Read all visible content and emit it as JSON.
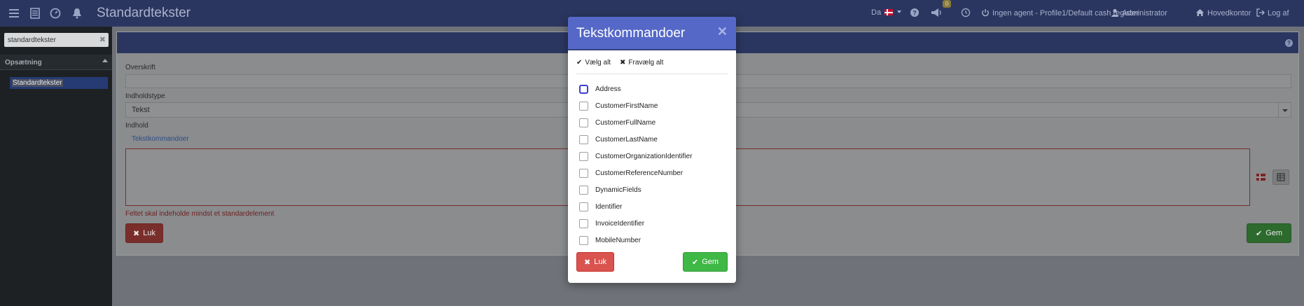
{
  "topbar": {
    "title": "Standardtekster",
    "language": "Da",
    "notification_count": "0",
    "agent": "Ingen agent - Profile1/Default cash register",
    "user": "Administrator",
    "office": "Hovedkontor",
    "logout": "Log af",
    "icons": [
      "menu-icon",
      "list-icon",
      "dashboard-icon",
      "bell-icon",
      "help-icon",
      "megaphone-icon",
      "clock-icon",
      "power-icon",
      "user-icon",
      "home-icon",
      "logout-icon"
    ]
  },
  "sidebar": {
    "search": {
      "value": "standardtekster",
      "placeholder": ""
    },
    "section": "Opsætning",
    "items": [
      {
        "label": "Standardtekster"
      }
    ]
  },
  "form": {
    "heading_label": "Overskrift",
    "heading_value": "",
    "content_type_label": "Indholdstype",
    "content_type_value": "Tekst",
    "content_label": "Indhold",
    "commands_link": "Tekstkommandoer",
    "error": "Feltet skal indeholde mindst et standardelement",
    "close_label": "Luk",
    "save_label": "Gem"
  },
  "modal": {
    "title": "Tekstkommandoer",
    "select_all": "Vælg alt",
    "deselect_all": "Fravælg alt",
    "items": [
      {
        "label": "Address",
        "checked": false
      },
      {
        "label": "CustomerFirstName",
        "checked": false
      },
      {
        "label": "CustomerFullName",
        "checked": false
      },
      {
        "label": "CustomerLastName",
        "checked": false
      },
      {
        "label": "CustomerOrganizationIdentifier",
        "checked": false
      },
      {
        "label": "CustomerReferenceNumber",
        "checked": false
      },
      {
        "label": "DynamicFields",
        "checked": false
      },
      {
        "label": "Identifier",
        "checked": false
      },
      {
        "label": "InvoiceIdentifier",
        "checked": false
      },
      {
        "label": "MobileNumber",
        "checked": false
      }
    ],
    "close_label": "Luk",
    "save_label": "Gem"
  },
  "colors": {
    "topbar": "#2b3660",
    "modal_header": "#5568c7",
    "danger": "#d9534f",
    "success": "#3fb845"
  }
}
